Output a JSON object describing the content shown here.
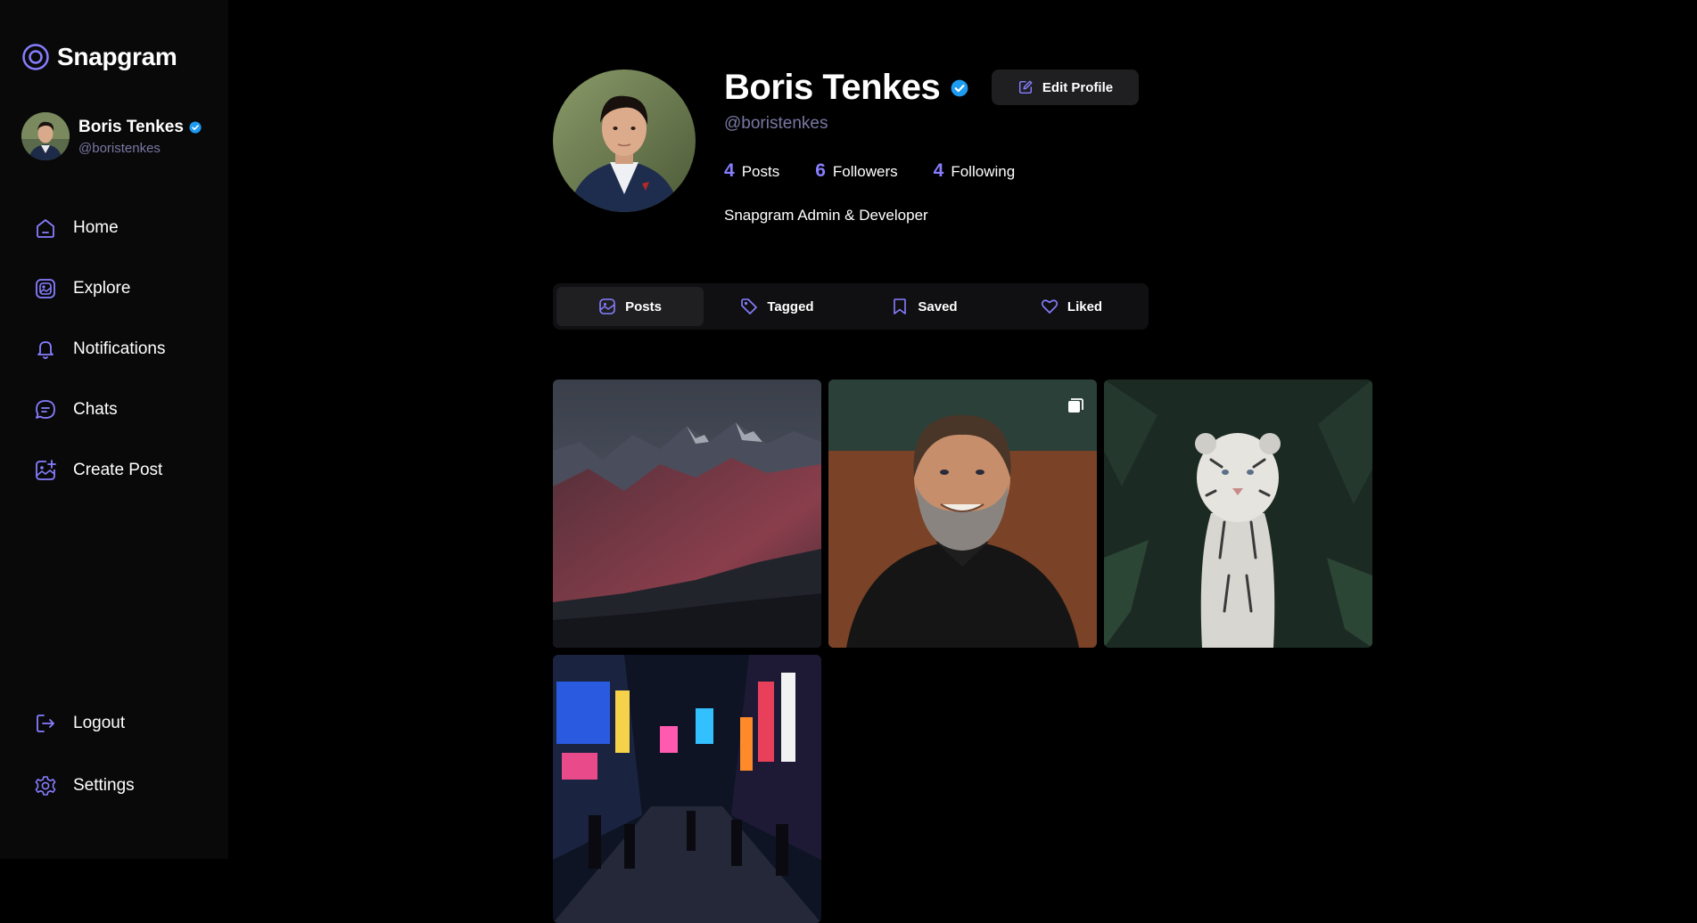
{
  "app": {
    "name": "Snapgram",
    "accent": "#877eff"
  },
  "current_user": {
    "name": "Boris Tenkes",
    "handle": "@boristenkes",
    "verified": true
  },
  "nav": {
    "items": [
      {
        "label": "Home",
        "icon": "home-icon"
      },
      {
        "label": "Explore",
        "icon": "explore-icon"
      },
      {
        "label": "Notifications",
        "icon": "bell-icon"
      },
      {
        "label": "Chats",
        "icon": "chat-icon"
      },
      {
        "label": "Create Post",
        "icon": "create-post-icon"
      }
    ],
    "logout": "Logout",
    "settings": "Settings"
  },
  "profile": {
    "name": "Boris Tenkes",
    "handle": "@boristenkes",
    "verified": true,
    "edit_label": "Edit Profile",
    "stats": [
      {
        "value": "4",
        "label": "Posts"
      },
      {
        "value": "6",
        "label": "Followers"
      },
      {
        "value": "4",
        "label": "Following"
      }
    ],
    "bio": "Snapgram Admin & Developer"
  },
  "tabs": [
    {
      "label": "Posts",
      "icon": "posts-icon",
      "active": true
    },
    {
      "label": "Tagged",
      "icon": "tag-icon",
      "active": false
    },
    {
      "label": "Saved",
      "icon": "bookmark-icon",
      "active": false
    },
    {
      "label": "Liked",
      "icon": "heart-icon",
      "active": false
    }
  ],
  "posts": [
    {
      "subject": "mountain landscape",
      "multiple": false
    },
    {
      "subject": "bearded man in hoodie",
      "multiple": true
    },
    {
      "subject": "white tiger",
      "multiple": false
    },
    {
      "subject": "neon city street at night",
      "multiple": false
    }
  ]
}
